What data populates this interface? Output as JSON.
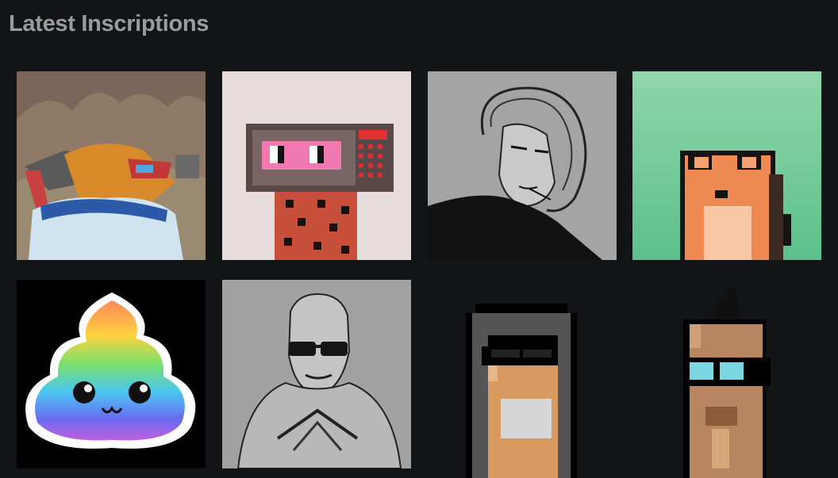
{
  "section": {
    "title": "Latest Inscriptions"
  },
  "inscriptions": [
    {
      "subject": "armored lizard creature"
    },
    {
      "subject": "pink glasses box head"
    },
    {
      "subject": "curly hair sketch portrait"
    },
    {
      "subject": "orange frog"
    },
    {
      "subject": "rainbow poop"
    },
    {
      "subject": "bald man with sunglasses"
    },
    {
      "subject": "hooded pixel character"
    },
    {
      "subject": "mohawk pixel character"
    }
  ],
  "colors": {
    "background": "#131416",
    "title": "#9b9b9b"
  }
}
